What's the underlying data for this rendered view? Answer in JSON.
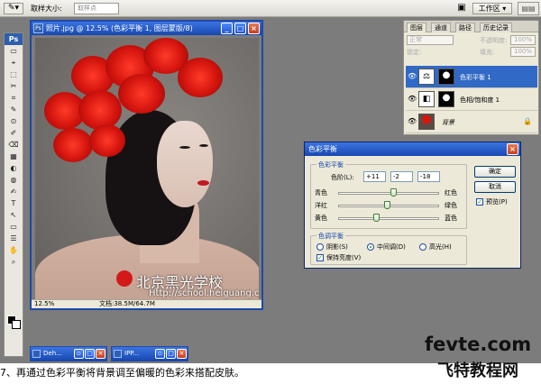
{
  "options_bar": {
    "tool_preset_icon": "eyedropper-icon",
    "sample_size_label": "取样大小:",
    "sample_size_value": "取样点",
    "workspace_label": "工作区 ▾"
  },
  "toolbox": {
    "logo": "Ps",
    "tools": [
      "▭",
      "⌖",
      "⬚",
      "✂",
      "⌗",
      "✎",
      "⊙",
      "✐",
      "⌫",
      "▦",
      "◐",
      "◍",
      "✍",
      "T",
      "↖",
      "▭",
      "☰",
      "✋",
      "⌕"
    ]
  },
  "document": {
    "title": "照片.jpg @ 12.5% (色彩平衡 1, 图层蒙版/8)",
    "zoom": "12.5%",
    "doc_size": "文档:38.5M/64.7M",
    "watermark_cn": "北京黑光学校",
    "watermark_en": "Http://school.heiguang.com"
  },
  "minimized_windows": [
    {
      "title": "Deh..."
    },
    {
      "title": "IPP..."
    }
  ],
  "layers_panel": {
    "tabs": [
      "图层",
      "通道",
      "路径",
      "历史记录"
    ],
    "blend_mode": "正常",
    "opacity_label": "不透明度:",
    "opacity_value": "100%",
    "lock_label": "锁定:",
    "fill_label": "填充:",
    "fill_value": "100%",
    "layers": [
      {
        "name": "色彩平衡 1",
        "selected": true
      },
      {
        "name": "色相/饱和度 1",
        "selected": false
      },
      {
        "name": "背景",
        "selected": false
      }
    ]
  },
  "color_balance": {
    "title": "色彩平衡",
    "group_balance": "色彩平衡",
    "levels_label": "色阶(L):",
    "levels": [
      "+11",
      "-2",
      "-18"
    ],
    "sliders": [
      {
        "left": "青色",
        "right": "红色",
        "value": 11
      },
      {
        "left": "洋红",
        "right": "绿色",
        "value": -2
      },
      {
        "left": "黄色",
        "right": "蓝色",
        "value": -18
      }
    ],
    "group_tone": "色调平衡",
    "tone_options": [
      "阴影(S)",
      "中间调(D)",
      "高光(H)"
    ],
    "tone_selected": "中间调(D)",
    "preserve_luminosity": "保持亮度(V)",
    "ok": "确定",
    "cancel": "取消",
    "preview": "预览(P)"
  },
  "site_logo": {
    "en": "fevte.com",
    "cn": "飞特教程网"
  },
  "caption": "7、再通过色彩平衡将背景调至偏暖的色彩来搭配皮肤。"
}
